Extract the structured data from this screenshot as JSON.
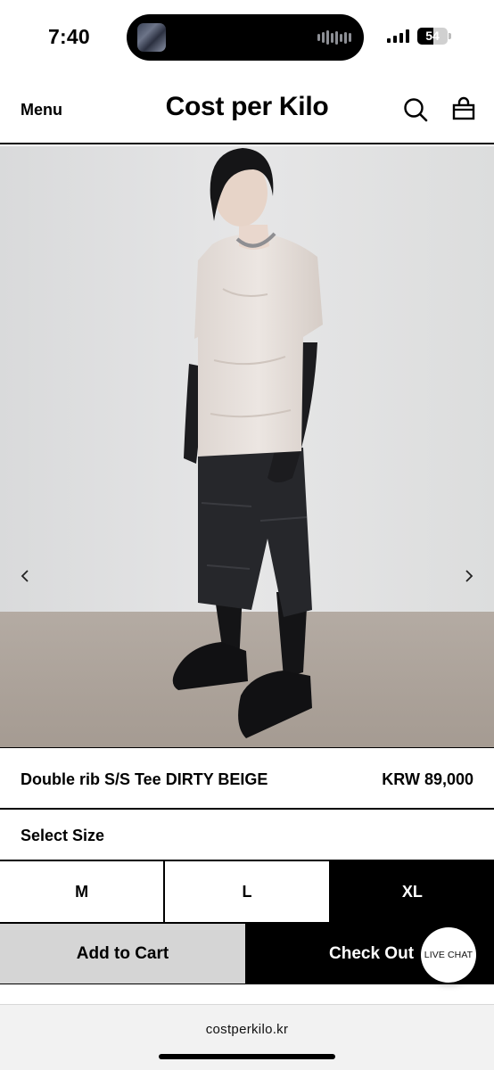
{
  "status_bar": {
    "time": "7:40",
    "battery": "54",
    "battery_level": 0.54
  },
  "header": {
    "menu_label": "Menu",
    "brand": "Cost per Kilo",
    "search_icon": "search-icon",
    "bag_icon": "shopping-bag-icon"
  },
  "gallery": {
    "prev_icon": "chevron-left-icon",
    "next_icon": "chevron-right-icon"
  },
  "product": {
    "name": "Double rib S/S Tee DIRTY BEIGE",
    "price": "KRW 89,000"
  },
  "sizes": {
    "label": "Select Size",
    "options": [
      "M",
      "L",
      "XL"
    ],
    "selected": "XL"
  },
  "actions": {
    "add_to_cart": "Add to Cart",
    "check_out": "Check Out",
    "live_chat": "LIVE CHAT"
  },
  "browser": {
    "url": "costperkilo.kr"
  },
  "colors": {
    "primary": "#000000",
    "secondary_button": "#d5d5d5",
    "background": "#ffffff"
  }
}
